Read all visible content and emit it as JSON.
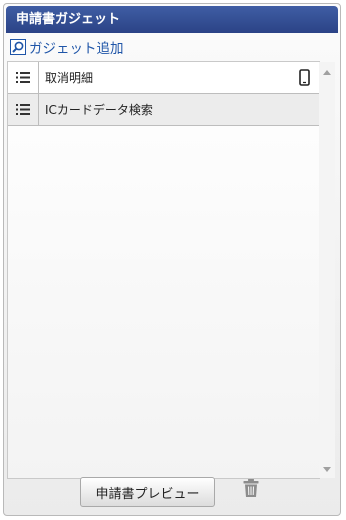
{
  "header": {
    "title": "申請書ガジェット"
  },
  "add_gadget": {
    "label": "ガジェット追加",
    "icon": "search-icon"
  },
  "gadgets": [
    {
      "label": "取消明細",
      "handle_icon": "list-icon",
      "mobile_icon": "mobile-phone-icon"
    },
    {
      "label": "ICカードデータ検索",
      "handle_icon": "list-icon"
    }
  ],
  "footer": {
    "preview_label": "申請書プレビュー",
    "delete_icon": "trash-icon"
  },
  "colors": {
    "header_bg": "#2f4a8f",
    "link": "#1f55a8"
  }
}
